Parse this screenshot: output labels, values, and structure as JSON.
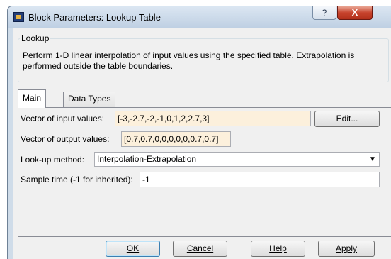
{
  "window": {
    "title": "Block Parameters: Lookup Table",
    "help_glyph": "?",
    "close_glyph": "X"
  },
  "group": {
    "legend": "Lookup",
    "description": "Perform 1-D linear interpolation of input values using the specified table.  Extrapolation is performed outside the table boundaries."
  },
  "tabs": [
    {
      "label": "Main",
      "active": true
    },
    {
      "label": "Data Types",
      "active": false
    }
  ],
  "main": {
    "input_label": "Vector of input values:",
    "input_value": "[-3,-2.7,-2,-1,0,1,2,2.7,3]",
    "edit_button": "Edit...",
    "output_label": "Vector of output values:",
    "output_value": "[0.7,0.7,0,0,0,0,0,0.7,0.7]",
    "method_label": "Look-up method:",
    "method_value": "Interpolation-Extrapolation",
    "sample_label": "Sample time (-1 for inherited):",
    "sample_value": "-1"
  },
  "buttons": {
    "ok": "OK",
    "cancel": "Cancel",
    "help": "Help",
    "apply": "Apply"
  },
  "colors": {
    "changed_field": "#fcf0dc",
    "close_button": "#c7432d",
    "titlebar": "#cfdce9"
  }
}
